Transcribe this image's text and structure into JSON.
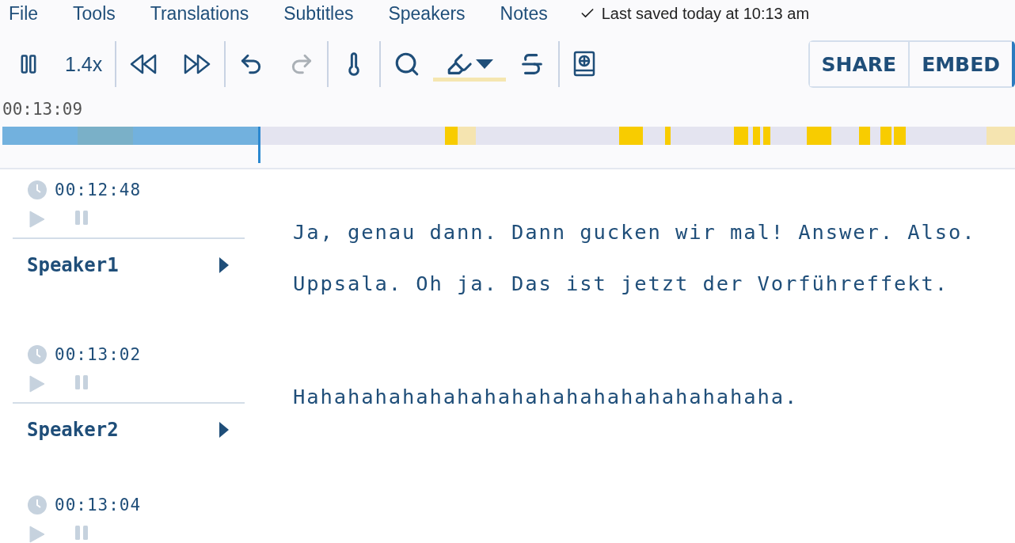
{
  "menu": [
    "File",
    "Tools",
    "Translations",
    "Subtitles",
    "Speakers",
    "Notes"
  ],
  "save_status": "Last saved today at 10:13 am",
  "toolbar": [
    {
      "kind": "pause",
      "disabled": false
    },
    {
      "kind": "speed",
      "label": "1.4x",
      "disabled": false
    },
    {
      "kind": "rewind",
      "disabled": false
    },
    {
      "kind": "forward",
      "disabled": false
    },
    {
      "kind": "undo",
      "disabled": false
    },
    {
      "kind": "redo",
      "disabled": true
    },
    {
      "kind": "thermometer",
      "disabled": false
    },
    {
      "kind": "search",
      "disabled": false
    },
    {
      "kind": "highlighter",
      "disabled": false,
      "selected": true
    },
    {
      "kind": "strikethrough",
      "disabled": false,
      "selected": false
    },
    {
      "kind": "glossary",
      "disabled": false
    }
  ],
  "actions": [
    "SHARE",
    "EMBED"
  ],
  "current_time": "00:13:09",
  "timeline": {
    "level": 0.254
  },
  "segments": [
    {
      "time": "00:12:48",
      "speaker": "Speaker1",
      "text": "Ja, genau dann. Dann gucken wir mal! Answer. Also. Uppsala. Oh ja. Das ist jetzt der Vorführeffekt."
    },
    {
      "time": "00:13:02",
      "speaker": "Speaker2",
      "text": "Hahahahahahahahahahahahahahahahahaha."
    },
    {
      "time": "00:13:04"
    }
  ]
}
